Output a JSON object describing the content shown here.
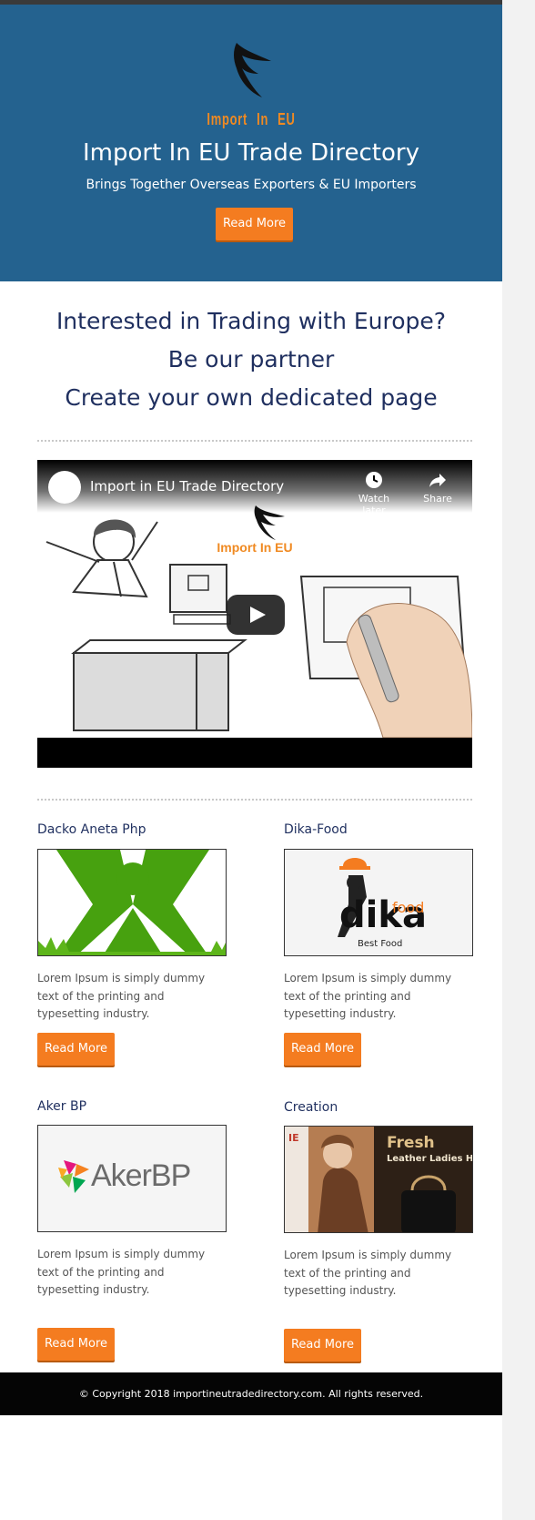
{
  "hero": {
    "brand": "Import In EU",
    "title": "Import In EU Trade Directory",
    "subtitle": "Brings Together Overseas Exporters & EU Importers",
    "button_label": "Read More"
  },
  "partner": {
    "line1": "Interested in Trading with Europe?",
    "line2": "Be our partner",
    "line3": "Create your own dedicated page"
  },
  "video": {
    "title": "Import in EU Trade Directory",
    "watch_later": "Watch later",
    "share": "Share",
    "brand": "Import In EU"
  },
  "cards": [
    {
      "title": "Dacko Aneta Php",
      "text": "Lorem Ipsum is simply dummy text of the printing and typesetting industry.",
      "button_label": "Read More"
    },
    {
      "title": "Dika-Food",
      "text": "Lorem Ipsum is simply dummy text of the printing and typesetting industry.",
      "button_label": "Read More",
      "logo_word": "dika",
      "logo_small": "food",
      "logo_tag": "Best Food"
    },
    {
      "title": "Aker BP",
      "text": "Lorem Ipsum is simply dummy text of the printing and typesetting industry.",
      "button_label": "Read More",
      "logo_word": "AkerBP"
    },
    {
      "title": "Creation",
      "text": "Lorem Ipsum is simply dummy text of the printing and typesetting industry.",
      "button_label": "Read More",
      "banner_big": "Fresh",
      "banner_small": "Leather Ladies Ha",
      "banner_side": "IE"
    }
  ],
  "footer": {
    "copyright": "© Copyright 2018 importineutradedirectory.com. All rights reserved."
  },
  "colors": {
    "hero_bg": "#24628f",
    "accent": "#f47c20",
    "heading": "#1f2f5f"
  }
}
